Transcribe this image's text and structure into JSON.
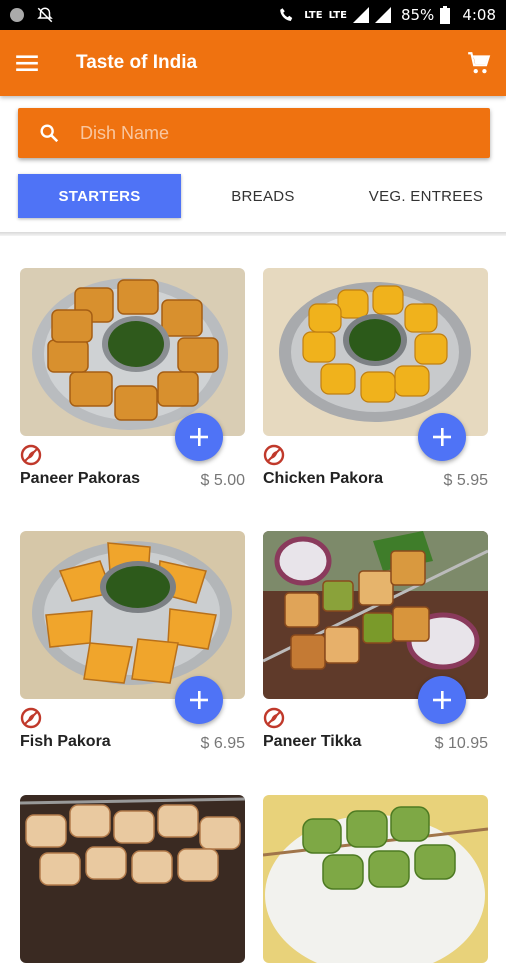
{
  "status_bar": {
    "network_left": "LTE",
    "network_right": "LTE",
    "battery": "85%",
    "time": "4:08"
  },
  "app": {
    "title": "Taste of India"
  },
  "search": {
    "placeholder": "Dish Name"
  },
  "tabs": [
    {
      "label": "STARTERS",
      "active": true
    },
    {
      "label": "BREADS",
      "active": false
    },
    {
      "label": "VEG. ENTREES",
      "active": false
    }
  ],
  "colors": {
    "primary": "#ef7210",
    "accent": "#4f73f6",
    "veg_icon": "#c0392b"
  },
  "menu_items": [
    {
      "name": "Paneer Pakoras",
      "price": "$ 5.00",
      "image": "pakoras-with-green-chutney"
    },
    {
      "name": "Chicken Pakora",
      "price": "$ 5.95",
      "image": "chicken-pakora-with-chutney"
    },
    {
      "name": "Fish Pakora",
      "price": "$ 6.95",
      "image": "fish-pakora-with-chutney"
    },
    {
      "name": "Paneer Tikka",
      "price": "$ 10.95",
      "image": "paneer-tikka-skewers"
    },
    {
      "name": "",
      "price": "",
      "image": "chicken-tikka-skewers"
    },
    {
      "name": "",
      "price": "",
      "image": "green-tikka-skewers"
    }
  ]
}
